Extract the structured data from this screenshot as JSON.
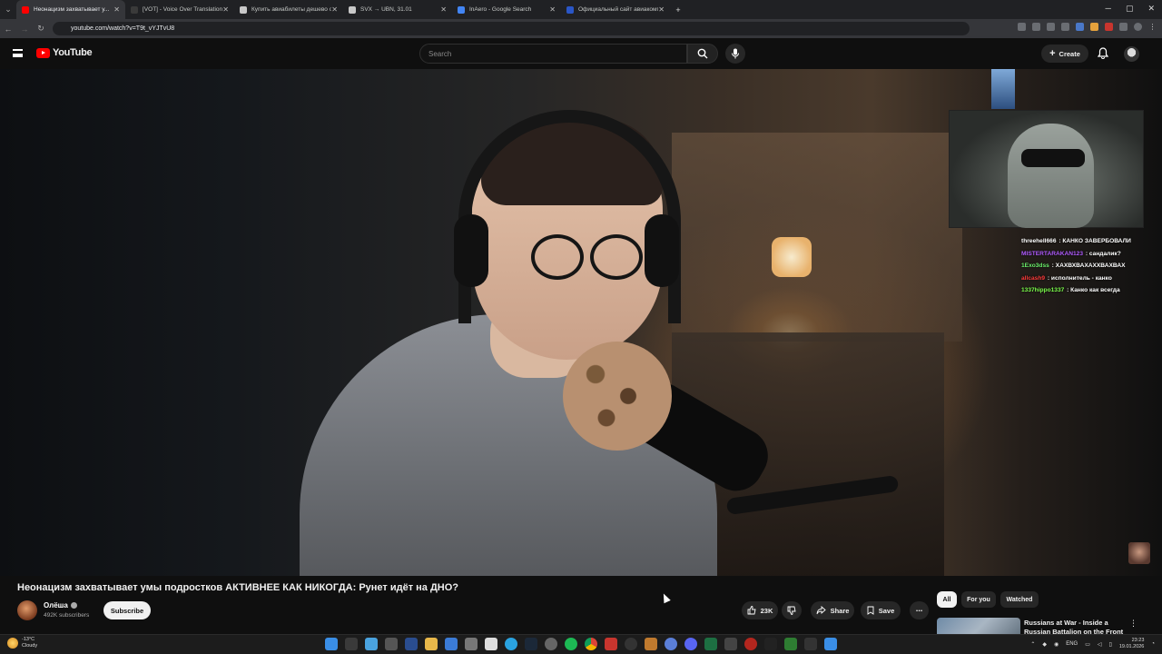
{
  "browser": {
    "tabs": [
      {
        "title": "Неонацизм захватывает у...",
        "active": true,
        "fav_color": "#ff0000"
      },
      {
        "title": "[VOT] - Voice Over Translation",
        "active": false,
        "fav_color": "#3a3a3a"
      },
      {
        "title": "Купить авиабилеты дешево о...",
        "active": false,
        "fav_color": "#c8c8c8"
      },
      {
        "title": "SVX → UBN, 31.01",
        "active": false,
        "fav_color": "#c8c8c8"
      },
      {
        "title": "InAero - Google Search",
        "active": false,
        "fav_color": "#4285f4"
      },
      {
        "title": "Официальный сайт авиакомп...",
        "active": false,
        "fav_color": "#2a56c6"
      }
    ],
    "url": "youtube.com/watch?v=T9t_vYJTvU8"
  },
  "yt": {
    "logo_text": "YouTube",
    "search_placeholder": "Search",
    "create_label": "Create"
  },
  "stream_chat": [
    {
      "user": "threehell666",
      "user_color": "#ffffff",
      "message": "КАНКО ЗАВЕРБОВАЛИ"
    },
    {
      "user": "MISTERTARAKAN123",
      "user_color": "#b05bff",
      "message": "сандалик?"
    },
    {
      "user": "1Exo3dss",
      "user_color": "#6cf06c",
      "message": "ХАХВХВАХАХХВАХВАХ"
    },
    {
      "user": "allcash9",
      "user_color": "#ff3b3b",
      "message": "исполнитель - канко"
    },
    {
      "user": "1337hippo1337",
      "user_color": "#7cff4c",
      "message": "Канко как всегда"
    }
  ],
  "video": {
    "title": "Неонацизм захватывает умы подростков АКТИВНЕЕ КАК НИКОГДА: Рунет идёт на ДНО?",
    "channel": "Олёша",
    "subscribers": "492K subscribers",
    "subscribe_label": "Subscribe",
    "likes": "23K",
    "share_label": "Share",
    "save_label": "Save"
  },
  "filters": [
    "All",
    "For you",
    "Watched"
  ],
  "recommended": {
    "title": "Russians at War - Inside a Russian Battalion on the Front"
  },
  "taskbar": {
    "temp": "-13°C",
    "weather": "Cloudy",
    "lang": "ENG",
    "time": "23:23",
    "date": "19.01.2026"
  }
}
